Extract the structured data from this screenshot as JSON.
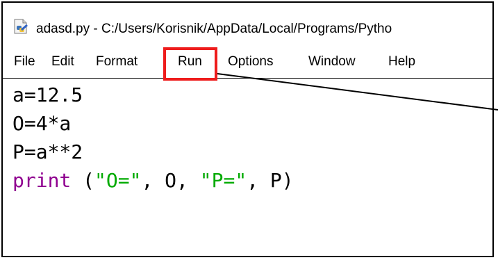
{
  "window": {
    "title": "adasd.py - C:/Users/Korisnik/AppData/Local/Programs/Pytho",
    "icon": "python-file-icon"
  },
  "menubar": {
    "items": [
      "File",
      "Edit",
      "Format",
      "Run",
      "Options",
      "Window",
      "Help"
    ],
    "highlighted": "Run",
    "highlight_color": "#ee1c1c"
  },
  "editor": {
    "lines": [
      {
        "text": "a=12.5"
      },
      {
        "text": "O=4*a"
      },
      {
        "text": "P=a**2"
      },
      {
        "tokens": [
          {
            "text": "print",
            "kind": "builtin"
          },
          {
            "text": " (",
            "kind": "plain"
          },
          {
            "text": "\"O=\"",
            "kind": "string"
          },
          {
            "text": ", O, ",
            "kind": "plain"
          },
          {
            "text": "\"P=\"",
            "kind": "string"
          },
          {
            "text": ", P)",
            "kind": "plain"
          }
        ]
      }
    ],
    "colors": {
      "builtin": "#900090",
      "string": "#00aa00",
      "plain": "#000000"
    }
  }
}
